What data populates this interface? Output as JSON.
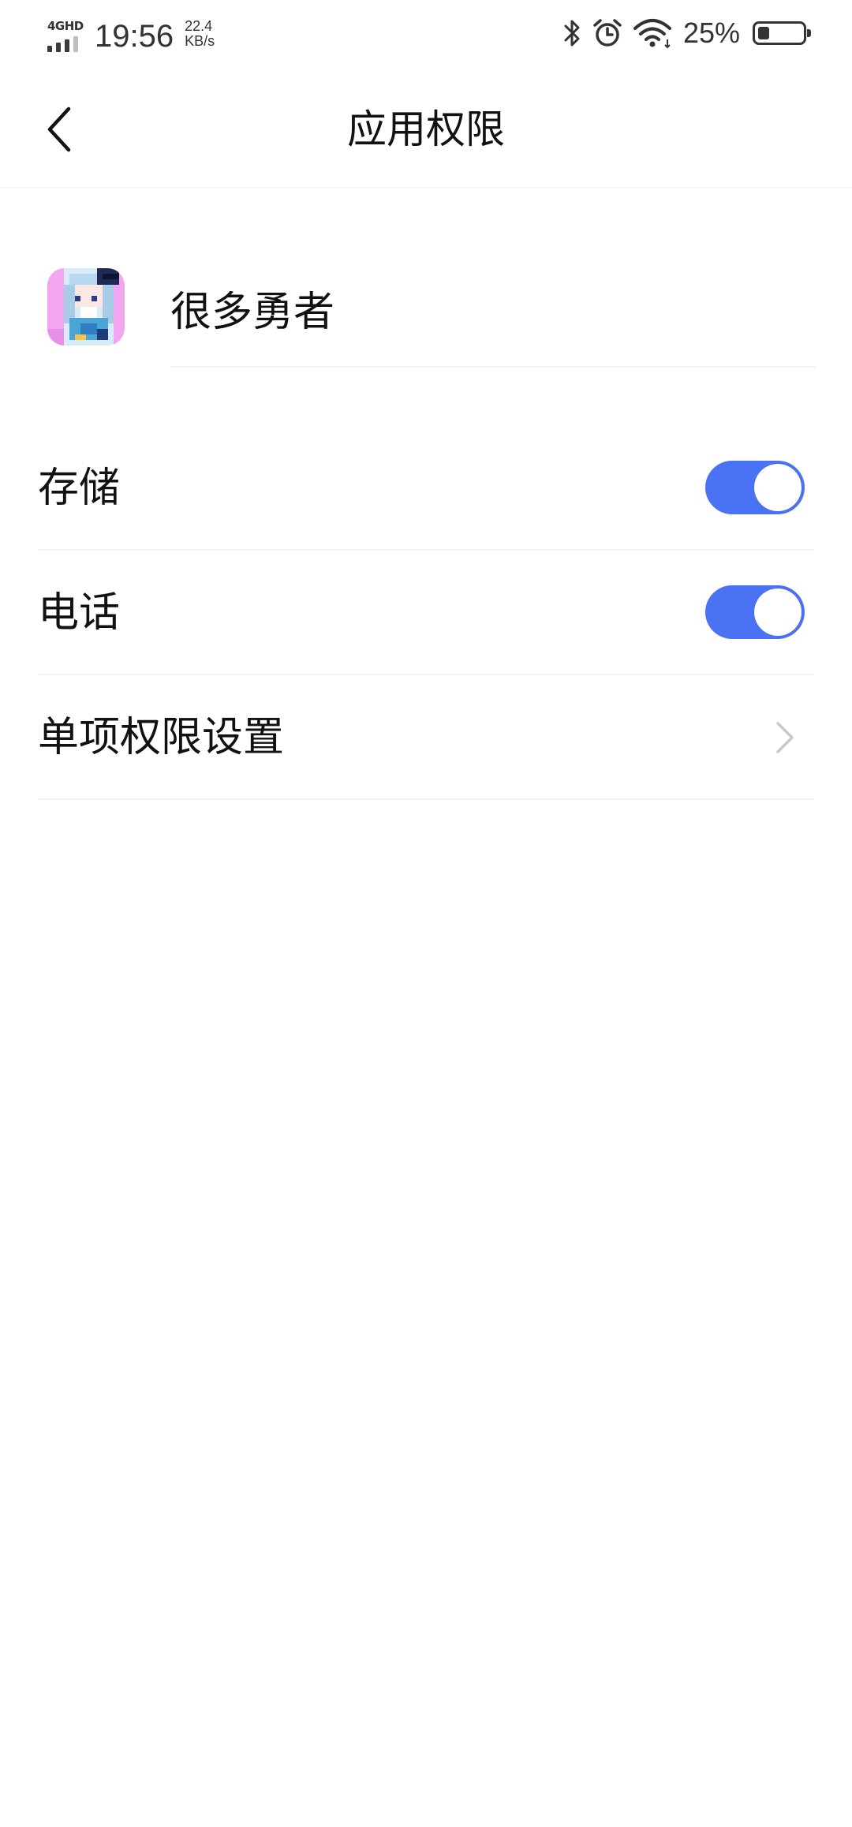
{
  "status_bar": {
    "network": "4GHD",
    "time": "19:56",
    "speed_value": "22.4",
    "speed_unit": "KB/s",
    "battery_percent": "25%",
    "battery_level": 0.25,
    "icons": [
      "signal-icon",
      "bluetooth-icon",
      "alarm-icon",
      "wifi-icon",
      "battery-icon"
    ]
  },
  "header": {
    "title": "应用权限",
    "back_icon": "back-arrow-icon"
  },
  "app": {
    "name": "很多勇者",
    "icon": "app-icon-pixel-character"
  },
  "permissions": [
    {
      "label": "存储",
      "type": "toggle",
      "enabled": true
    },
    {
      "label": "电话",
      "type": "toggle",
      "enabled": true
    },
    {
      "label": "单项权限设置",
      "type": "link",
      "icon": "chevron-right-icon"
    }
  ],
  "colors": {
    "accent": "#4a72f5",
    "text": "#111111",
    "divider": "#f1f1f1",
    "chevron": "#c8c8c8"
  }
}
